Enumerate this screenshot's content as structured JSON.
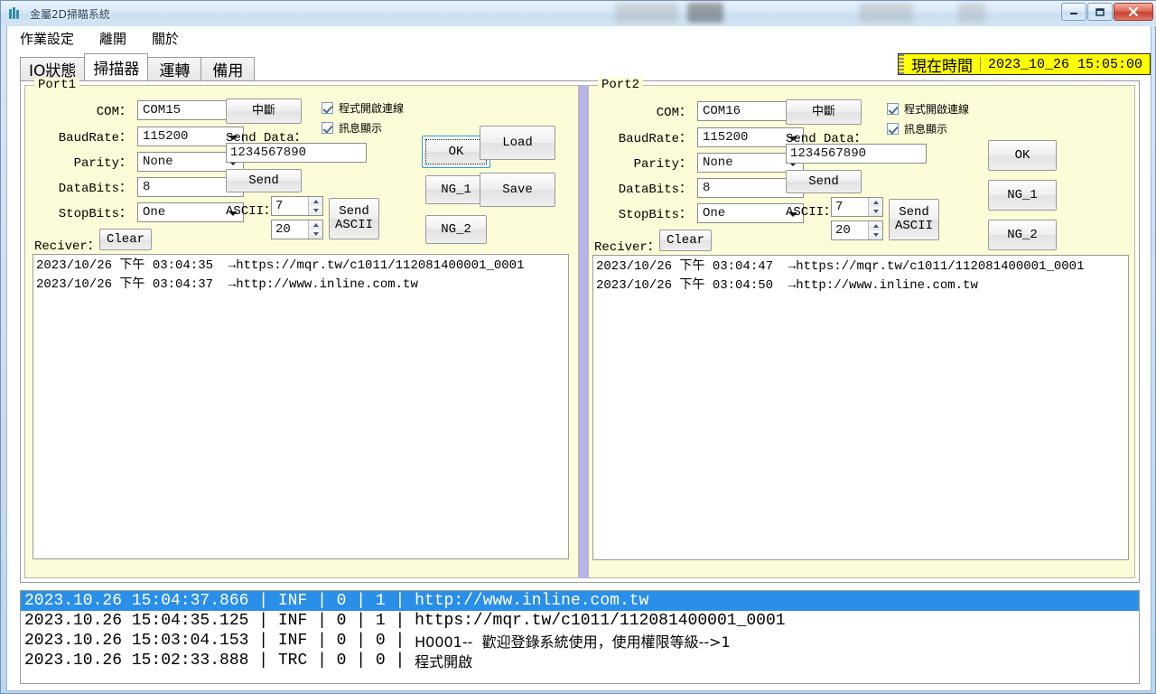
{
  "window": {
    "title": "金屬2D掃瞄系統",
    "minimize_label": "—",
    "maximize_label": "❐",
    "close_label": "✕"
  },
  "menu": {
    "items": [
      {
        "label": "作業設定"
      },
      {
        "label": "離開"
      },
      {
        "label": "關於"
      }
    ]
  },
  "clock": {
    "label": "現在時間",
    "value": "2023_10_26 15:05:00",
    "background": "#ffff00"
  },
  "tabs": [
    {
      "label": "IO狀態",
      "active": false
    },
    {
      "label": "掃描器",
      "active": true
    },
    {
      "label": "運轉",
      "active": false
    },
    {
      "label": "備用",
      "active": false
    }
  ],
  "port1": {
    "group_title": "Port1",
    "fields": {
      "com_label": "COM：",
      "com_value": "COM15",
      "baud_label": "BaudRate：",
      "baud_value": "115200",
      "parity_label": "Parity：",
      "parity_value": "None",
      "databits_label": "DataBits：",
      "databits_value": "8",
      "stopbits_label": "StopBits：",
      "stopbits_value": "One",
      "reciver_label": "Reciver："
    },
    "buttons": {
      "disconnect": "中斷",
      "send": "Send",
      "send_ascii": "Send\nASCII",
      "clear": "Clear",
      "ok": "OK",
      "ng1": "NG_1",
      "ng2": "NG_2",
      "load": "Load",
      "save": "Save"
    },
    "send_data_label": "Send Data：",
    "send_data_value": "1234567890",
    "ascii_label": "ASCII：",
    "ascii_value_1": "7",
    "ascii_value_2": "20",
    "checkboxes": [
      {
        "label": "程式開啟連線",
        "checked": true
      },
      {
        "label": "訊息顯示",
        "checked": true
      }
    ],
    "receiver_lines": [
      "2023/10/26 下午 03:04:35  →https://mqr.tw/c1011/112081400001_0001",
      "2023/10/26 下午 03:04:37  →http://www.inline.com.tw"
    ]
  },
  "port2": {
    "group_title": "Port2",
    "fields": {
      "com_label": "COM：",
      "com_value": "COM16",
      "baud_label": "BaudRate：",
      "baud_value": "115200",
      "parity_label": "Parity：",
      "parity_value": "None",
      "databits_label": "DataBits：",
      "databits_value": "8",
      "stopbits_label": "StopBits：",
      "stopbits_value": "One",
      "reciver_label": "Reciver："
    },
    "buttons": {
      "disconnect": "中斷",
      "send": "Send",
      "send_ascii": "Send\nASCII",
      "clear": "Clear",
      "ok": "OK",
      "ng1": "NG_1",
      "ng2": "NG_2"
    },
    "send_data_label": "Send Data：",
    "send_data_value": "1234567890",
    "ascii_label": "ASCII：",
    "ascii_value_1": "7",
    "ascii_value_2": "20",
    "checkboxes": [
      {
        "label": "程式開啟連線",
        "checked": true
      },
      {
        "label": "訊息顯示",
        "checked": true
      }
    ],
    "receiver_lines": [
      "2023/10/26 下午 03:04:47  →https://mqr.tw/c1011/112081400001_0001",
      "2023/10/26 下午 03:04:50  →http://www.inline.com.tw"
    ]
  },
  "log": {
    "selected_index": 0,
    "rows": [
      {
        "timestamp": "2023.10.26 15:04:37.866",
        "level": "INF",
        "c1": "0",
        "c2": "1",
        "message": "http://www.inline.com.tw"
      },
      {
        "timestamp": "2023.10.26 15:04:35.125",
        "level": "INF",
        "c1": "0",
        "c2": "1",
        "message": "https://mqr.tw/c1011/112081400001_0001"
      },
      {
        "timestamp": "2023.10.26 15:03:04.153",
        "level": "INF",
        "c1": "0",
        "c2": "0",
        "message": "H0001--  歡迎登錄系統使用，使用權限等級-->1"
      },
      {
        "timestamp": "2023.10.26 15:02:33.888",
        "level": "TRC",
        "c1": "0",
        "c2": "0",
        "message": "程式開啟"
      }
    ]
  }
}
